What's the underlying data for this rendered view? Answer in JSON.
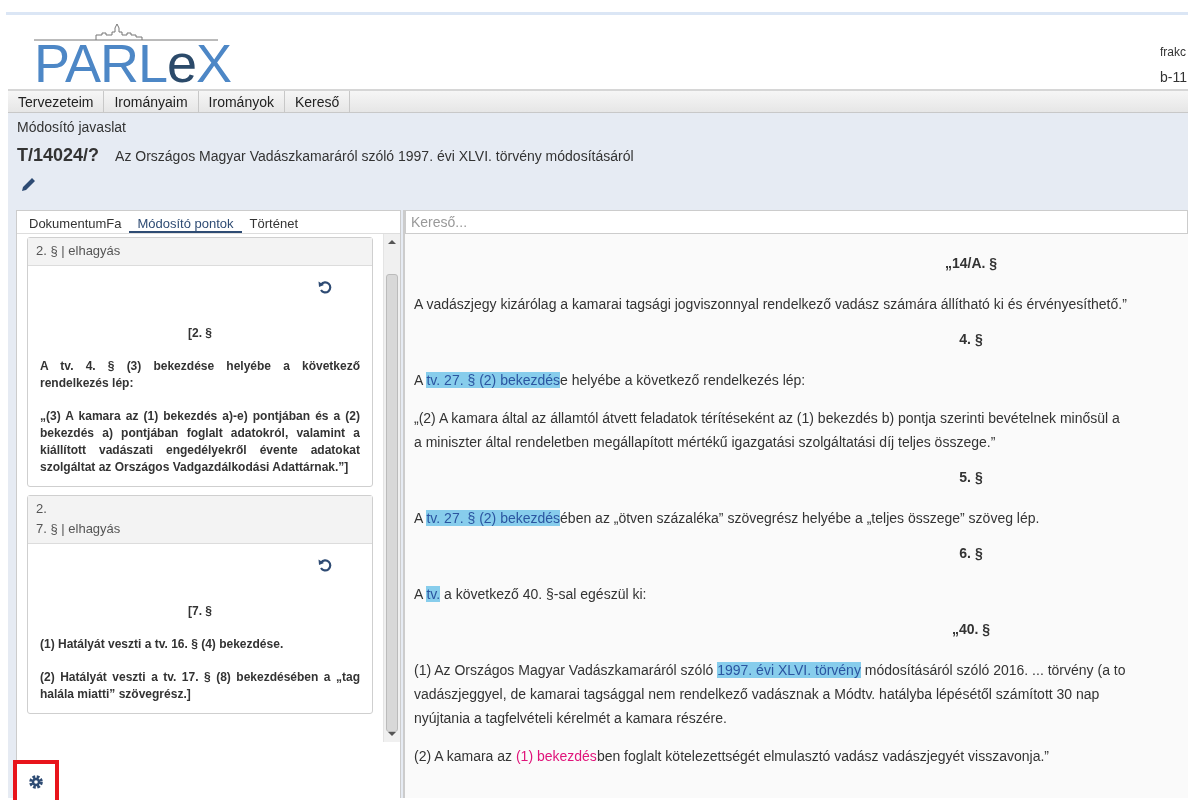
{
  "header": {
    "logo": [
      "PARL",
      "e",
      "X"
    ],
    "user_lines": [
      "frakc",
      "b-11"
    ]
  },
  "menu": [
    {
      "label": "Tervezeteim"
    },
    {
      "label": "Irományaim"
    },
    {
      "label": "Irományok"
    },
    {
      "label": "Kereső"
    }
  ],
  "doc_type": "Módosító javaslat",
  "bill": {
    "number": "T/14024/?",
    "title": "Az Országos Magyar Vadászkamaráról szóló 1997. évi XLVI. törvény módosításáról"
  },
  "left_tabs": [
    {
      "label": "DokumentumFa",
      "selected": false
    },
    {
      "label": "Módosító pontok",
      "selected": true
    },
    {
      "label": "Történet",
      "selected": false
    }
  ],
  "amendments": [
    {
      "header_lines": [
        "2. § | elhagyás"
      ],
      "heading": "[2. §",
      "paragraphs": [
        "A tv. 4. § (3) bekezdése helyébe a következő rendelkezés lép:",
        "„(3) A kamara az (1) bekezdés a)-e) pontjában és a (2) bekezdés a) pontjában foglalt adatokról, valamint a kiállított vadászati engedélyekről évente adatokat szolgáltat az Országos Vadgazdálkodási Adattárnak.”]"
      ]
    },
    {
      "header_lines": [
        "2.",
        "7. § | elhagyás"
      ],
      "heading": "[7. §",
      "paragraphs": [
        "(1) Hatályát veszti a tv. 16. § (4) bekezdése.",
        "(2) Hatályát veszti a tv. 17. § (8) bekezdésében a „tag halála miatti” szövegrész.]"
      ]
    }
  ],
  "search": {
    "placeholder": "Kereső..."
  },
  "document": [
    {
      "kind": "heading",
      "text": "„14/A. §"
    },
    {
      "kind": "paragraph",
      "lines": [
        [
          {
            "kind": "text",
            "text": "A vadászjegy kizárólag a kamarai tagsági jogviszonnyal rendelkező vadász számára állítható ki és érvényesíthető.”"
          }
        ]
      ]
    },
    {
      "kind": "heading",
      "text": "4. §"
    },
    {
      "kind": "paragraph",
      "lines": [
        [
          {
            "kind": "text",
            "text": "A "
          },
          {
            "kind": "reference",
            "text": "tv. 27. § (2) bekezdés"
          },
          {
            "kind": "text",
            "text": "e helyébe a következő rendelkezés lép:"
          }
        ]
      ]
    },
    {
      "kind": "paragraph",
      "lines": [
        [
          {
            "kind": "text",
            "text": "„(2) A kamara által az államtól átvett feladatok térítéseként az (1) bekezdés b) pontja szerinti bevételnek minősül a"
          }
        ],
        [
          {
            "kind": "text",
            "text": "a miniszter által rendeletben megállapított mértékű igazgatási szolgáltatási díj teljes összege.”"
          }
        ]
      ]
    },
    {
      "kind": "heading",
      "text": "5. §"
    },
    {
      "kind": "paragraph",
      "lines": [
        [
          {
            "kind": "text",
            "text": "A "
          },
          {
            "kind": "reference",
            "text": "tv. 27. § (2) bekezdés"
          },
          {
            "kind": "text",
            "text": "ében az „ötven százaléka” szövegrész helyébe a „teljes összege” szöveg lép."
          }
        ]
      ]
    },
    {
      "kind": "heading",
      "text": "6. §"
    },
    {
      "kind": "paragraph",
      "lines": [
        [
          {
            "kind": "text",
            "text": "A "
          },
          {
            "kind": "reference",
            "text": "tv."
          },
          {
            "kind": "text",
            "text": " a következő 40. §-sal egészül ki:"
          }
        ]
      ]
    },
    {
      "kind": "heading",
      "text": "„40. §"
    },
    {
      "kind": "paragraph",
      "lines": [
        [
          {
            "kind": "text",
            "text": "(1) Az Országos Magyar Vadászkamaráról szóló "
          },
          {
            "kind": "reference",
            "text": "1997. évi XLVI. törvény"
          },
          {
            "kind": "text",
            "text": " módosításáról szóló 2016. ... törvény (a to"
          }
        ],
        [
          {
            "kind": "text",
            "text": "vadászjeggyel, de kamarai tagsággal nem rendelkező vadásznak a Módtv. hatályba lépésétől számított 30 nap"
          }
        ],
        [
          {
            "kind": "text",
            "text": "nyújtania a tagfelvételi kérelmét a kamara részére."
          }
        ]
      ]
    },
    {
      "kind": "paragraph",
      "lines": [
        [
          {
            "kind": "text",
            "text": "(2) A kamara az "
          },
          {
            "kind": "link",
            "text": "(1) bekezdés"
          },
          {
            "kind": "text",
            "text": "ben foglalt kötelezettségét elmulasztó vadász vadászjegyét visszavonja.”"
          }
        ]
      ]
    }
  ]
}
